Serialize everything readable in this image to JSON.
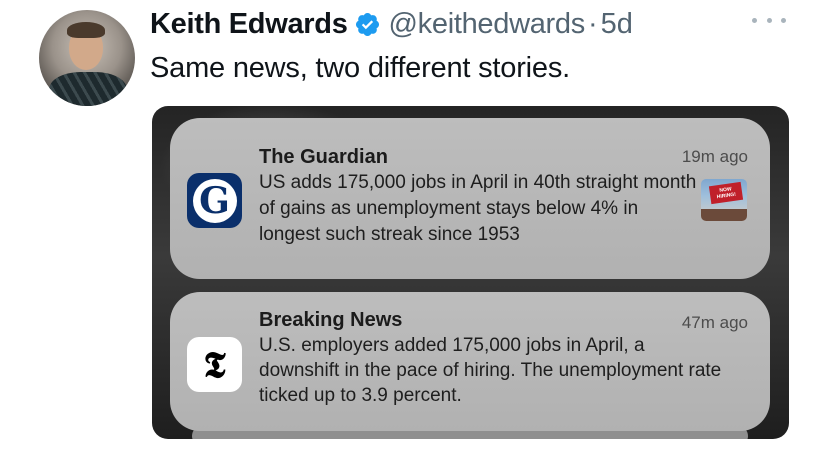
{
  "author": {
    "name": "Keith Edwards",
    "handle": "@keithedwards",
    "separator": "·",
    "time": "5d",
    "verified": true,
    "verified_color": "#1d9bf0"
  },
  "tweet": {
    "text": "Same news, two different stories."
  },
  "icons": {
    "more": "more-options-icon",
    "verified": "verified-badge-icon"
  },
  "notifications": [
    {
      "app": "The Guardian",
      "icon_glyph": "G",
      "icon_color": "#0a2f6b",
      "time": "19m ago",
      "text": "US adds 175,000 jobs in April in 40th straight month of gains as unemployment stays below 4% in longest such streak since 1953",
      "thumbnail_text": "NOW HIRING!"
    },
    {
      "app": "Breaking News",
      "icon_glyph": "𝕿",
      "icon_color": "#ffffff",
      "time": "47m ago",
      "text": "U.S. employers added 175,000 jobs in April, a downshift in the pace of hiring. The unemployment rate ticked up to 3.9 percent."
    }
  ]
}
